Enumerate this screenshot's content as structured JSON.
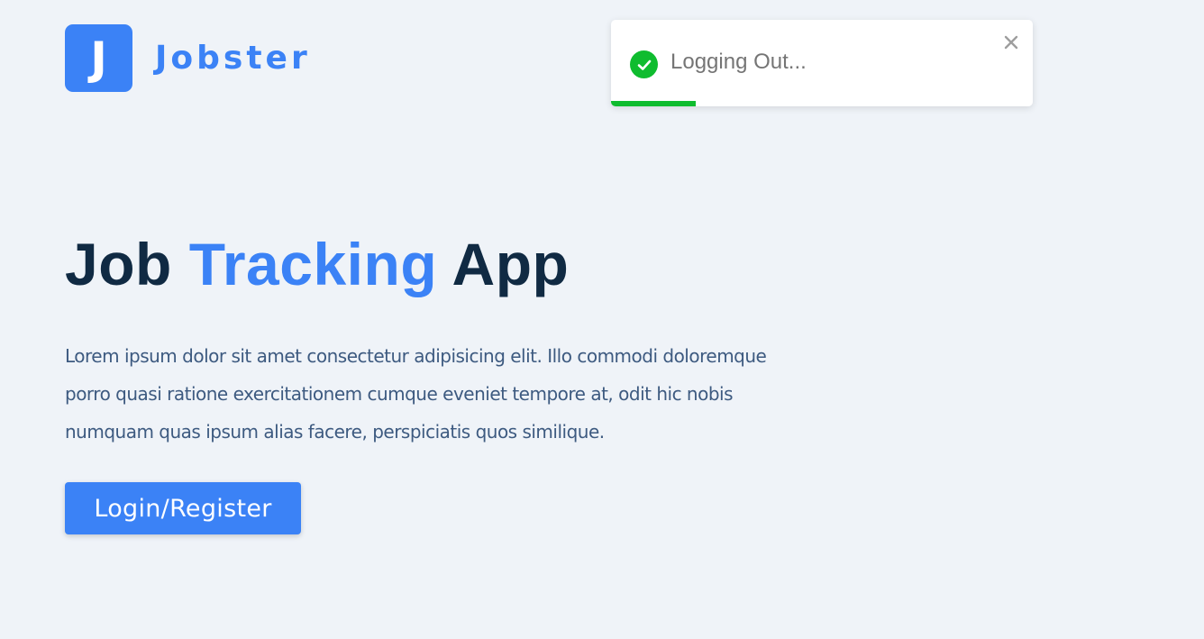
{
  "header": {
    "logo_letter": "J",
    "brand_name": "Jobster"
  },
  "hero": {
    "title_part1": "Job",
    "title_accent": "Tracking",
    "title_part2": "App",
    "description": "Lorem ipsum dolor sit amet consectetur adipisicing elit. Illo commodi doloremque porro quasi ratione exercitationem cumque eveniet tempore at, odit hic nobis numquam quas ipsum alias facere, perspiciatis quos similique.",
    "cta_label": "Login/Register"
  },
  "toast": {
    "message": "Logging Out...",
    "status_icon": "check-circle-icon",
    "close_icon": "close-icon",
    "progress_fraction": 0.2
  },
  "colors": {
    "primary": "#3b82f6",
    "heading": "#102a43",
    "body_text": "#3d5a80",
    "background": "#eff3f8",
    "success": "#0fbc2f"
  }
}
